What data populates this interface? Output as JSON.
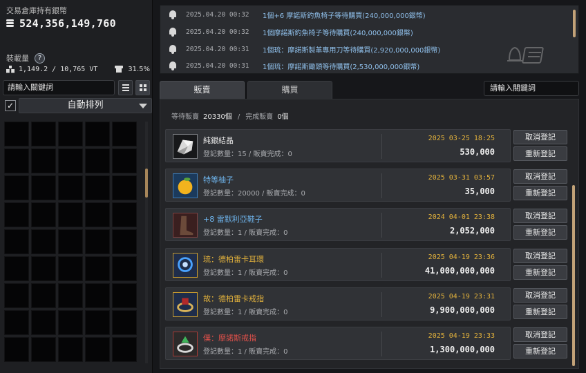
{
  "wallet": {
    "title": "交易倉庫持有銀幣",
    "amount": "524,356,149,760"
  },
  "weight": {
    "title": "裝載量",
    "help_icon": "?",
    "value": "1,149.2 / 10,765 VT",
    "percent": "31.5%"
  },
  "inventory": {
    "search_placeholder": "請輸入關鍵詞",
    "sort_checked": true,
    "sort_label": "自動排列",
    "slots": 45
  },
  "notifications": [
    {
      "time": "2025.04.20 00:32",
      "text": "1個+6 摩諾斯釣魚椅子等待購買(240,000,000銀幣)"
    },
    {
      "time": "2025.04.20 00:32",
      "text": "1個摩諾斯釣魚椅子等待購買(240,000,000銀幣)"
    },
    {
      "time": "2025.04.20 00:31",
      "text": "1個琉：摩諾斯製革專用刀等待購買(2,920,000,000銀幣)"
    },
    {
      "time": "2025.04.20 00:31",
      "text": "1個琉：摩諾斯鋤頭等待購買(2,530,000,000銀幣)"
    }
  ],
  "tabs": {
    "sell": "販賣",
    "buy": "購買",
    "search_placeholder": "請輸入關鍵詞"
  },
  "summary": {
    "waiting_label": "等待販賣",
    "waiting_value": "20330個",
    "separator": "/",
    "done_label": "完成販賣",
    "done_value": "0個"
  },
  "actions": {
    "cancel": "取消登記",
    "relist": "重新登記"
  },
  "listings": [
    {
      "name": "純銀結晶",
      "meta": "登記數量：15 / 販賣完成：0",
      "date": "2025 03-25 18:25",
      "price": "530,000",
      "name_color": "#e6e6e6",
      "icon": "silver-crystal-icon",
      "enhance": ""
    },
    {
      "name": "特等柚子",
      "meta": "登記數量：20000 / 販賣完成：0",
      "date": "2025 03-31 03:57",
      "price": "35,000",
      "name_color": "#6fb6ef",
      "icon": "grapefruit-icon",
      "enhance": ""
    },
    {
      "name": "+8 雷默利亞鞋子",
      "meta": "登記數量：1 / 販賣完成：0",
      "date": "2024 04-01 23:38",
      "price": "2,052,000",
      "name_color": "#6fb6ef",
      "icon": "shoes-icon",
      "enhance": "+8"
    },
    {
      "name": "琉：德柏雷卡耳環",
      "meta": "登記數量：1 / 販賣完成：0",
      "date": "2025 04-19 23:36",
      "price": "41,000,000,000",
      "name_color": "#e3b23c",
      "icon": "earring-icon",
      "enhance": "IV"
    },
    {
      "name": "故：德柏雷卡戒指",
      "meta": "登記數量：1 / 販賣完成：0",
      "date": "2025 04-19 23:31",
      "price": "9,900,000,000",
      "name_color": "#e3b23c",
      "icon": "ring-icon",
      "enhance": "III"
    },
    {
      "name": "僕：摩諾斯戒指",
      "meta": "登記數量：1 / 販賣完成：0",
      "date": "2025 04-19 23:33",
      "price": "1,300,000,000",
      "name_color": "#e0504a",
      "icon": "monos-ring-icon",
      "enhance": "II"
    }
  ]
}
